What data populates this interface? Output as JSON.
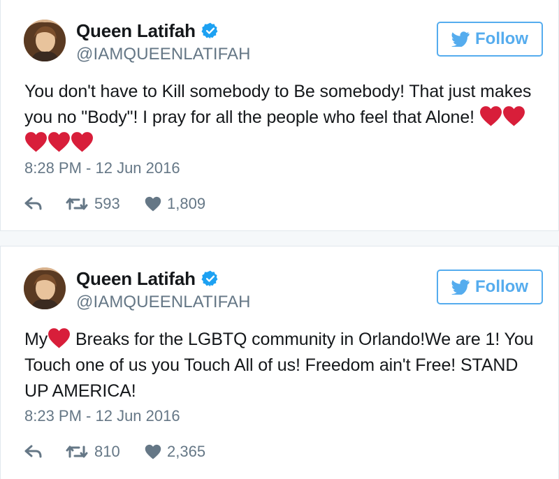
{
  "tweets": [
    {
      "display_name": "Queen Latifah",
      "handle": "@IAMQUEENLATIFAH",
      "follow_label": "Follow",
      "text_before": "You don't have to Kill somebody to Be somebody! That just makes you no \"Body\"! I pray for all the people who feel that Alone! ",
      "text_after": "",
      "hearts_before": 0,
      "hearts_after": 5,
      "timestamp": "8:28 PM - 12 Jun 2016",
      "retweets": "593",
      "likes": "1,809"
    },
    {
      "display_name": "Queen Latifah",
      "handle": "@IAMQUEENLATIFAH",
      "follow_label": "Follow",
      "text_before": "My",
      "text_after": " Breaks for the LGBTQ community in Orlando!We are 1! You Touch one of us you Touch All of us! Freedom ain't Free! STAND UP AMERICA!",
      "hearts_before": 0,
      "hearts_after": 1,
      "timestamp": "8:23 PM - 12 Jun 2016",
      "retweets": "810",
      "likes": "2,365"
    }
  ],
  "colors": {
    "brand": "#55acee",
    "text": "#14171a",
    "muted": "#657786",
    "heart": "#e0245e",
    "verified": "#1da1f2"
  }
}
